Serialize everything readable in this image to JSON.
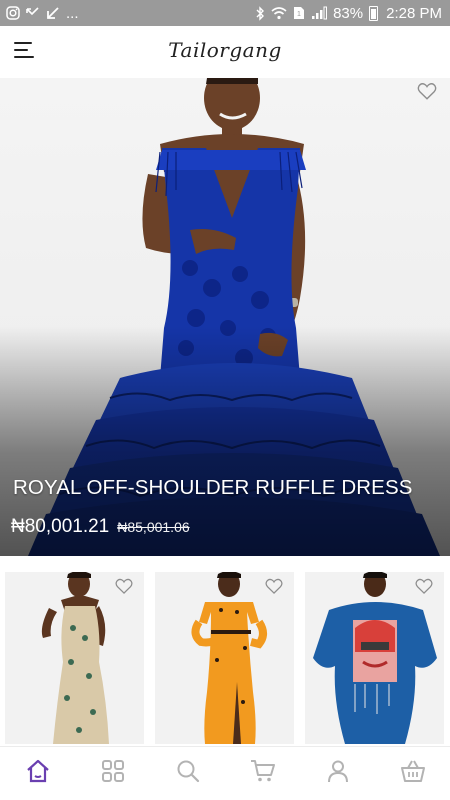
{
  "status_bar": {
    "left_icons": [
      "instagram-icon",
      "missed-call-icon",
      "arrow-down-left-icon",
      "more-dots"
    ],
    "more_text": "...",
    "battery_percent": "83%",
    "time": "2:28 PM",
    "right_icons": [
      "bluetooth-icon",
      "wifi-icon",
      "sim-icon",
      "signal-icon",
      "battery-icon"
    ]
  },
  "header": {
    "brand": "Tailorgang",
    "menu_icon": "hamburger-menu-icon"
  },
  "hero": {
    "title": "ROYAL OFF-SHOULDER RUFFLE DRESS",
    "price": "₦80,001.21",
    "old_price": "₦85,001.06",
    "favorite_icon": "heart-outline-icon",
    "dress_color": "#1535a8"
  },
  "products": [
    {
      "favorite_icon": "heart-outline-icon",
      "dress_color": "#d9c9a8"
    },
    {
      "favorite_icon": "heart-outline-icon",
      "dress_color": "#f29a1f"
    },
    {
      "favorite_icon": "heart-outline-icon",
      "dress_color": "#1d5fa6"
    }
  ],
  "bottom_nav": {
    "items": [
      "home-icon",
      "grid-icon",
      "search-icon",
      "cart-icon",
      "user-icon",
      "basket-icon"
    ],
    "active": "home-icon",
    "active_color": "#6a3fb0",
    "inactive_color": "#b3b3b3"
  }
}
